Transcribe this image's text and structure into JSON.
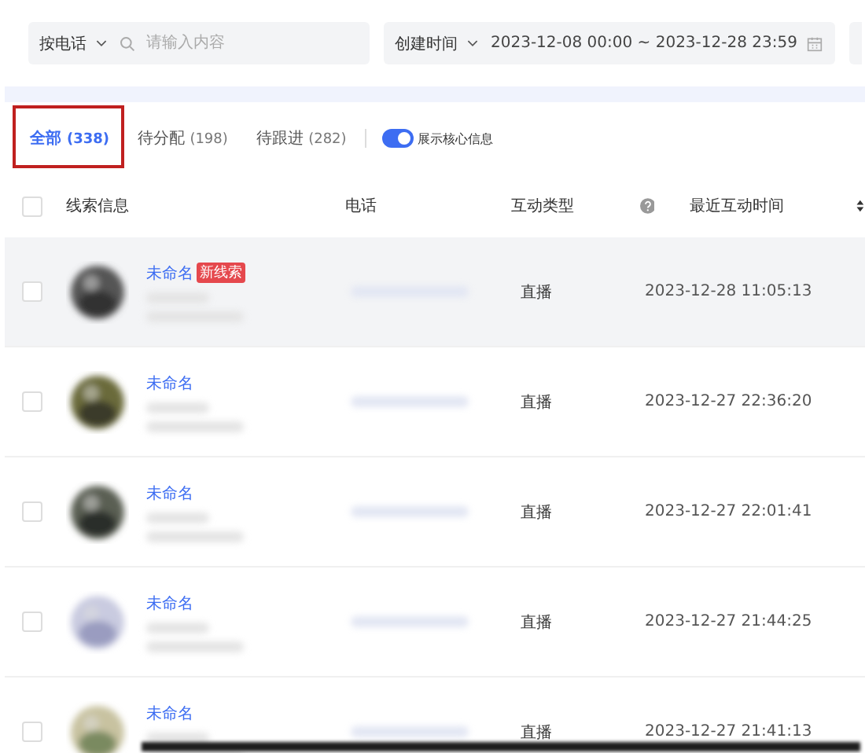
{
  "filters": {
    "search_by": "按电话",
    "search": {
      "placeholder": "请输入内容"
    },
    "date_by": "创建时间",
    "date_range": "2023-12-08 00:00 ~ 2023-12-28 23:59"
  },
  "tabs": [
    {
      "label": "全部",
      "count": "(338)",
      "selected": true
    },
    {
      "label": "待分配",
      "count": "(198)",
      "selected": false
    },
    {
      "label": "待跟进",
      "count": "(282)",
      "selected": false
    }
  ],
  "toggle": {
    "label": "展示核心信息",
    "on": true
  },
  "table": {
    "all_checked": false,
    "columns": [
      "线索信息",
      "电话",
      "互动类型",
      "最近互动时间"
    ],
    "rows": [
      {
        "name": "未命名",
        "badge": "新线索",
        "type": "直播",
        "time": "2023-12-28 11:05:13",
        "hovered": true,
        "checked": false
      },
      {
        "name": "未命名",
        "type": "直播",
        "time": "2023-12-27 22:36:20",
        "hovered": false,
        "checked": false
      },
      {
        "name": "未命名",
        "type": "直播",
        "time": "2023-12-27 22:01:41",
        "hovered": false,
        "checked": false
      },
      {
        "name": "未命名",
        "type": "直播",
        "time": "2023-12-27 21:44:25",
        "hovered": false,
        "checked": false
      },
      {
        "name": "未命名",
        "type": "直播",
        "time": "2023-12-27 21:41:13",
        "hovered": false,
        "checked": false
      }
    ]
  }
}
